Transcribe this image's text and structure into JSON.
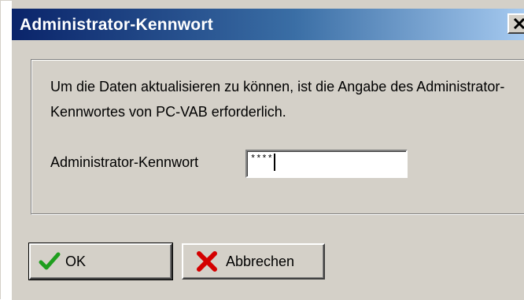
{
  "window": {
    "title": "Administrator-Kennwort"
  },
  "dialog": {
    "message": "Um die Daten aktualisieren zu können, ist die Angabe des Administrator-Kennwortes von PC-VAB erforderlich.",
    "password_label": "Administrator-Kennwort",
    "password_value": "****"
  },
  "buttons": {
    "ok_label": "OK",
    "cancel_label": "Abbrechen"
  },
  "icons": {
    "close": "close-icon",
    "ok": "checkmark-icon",
    "cancel": "x-mark-icon"
  },
  "colors": {
    "titlebar_start": "#0a246a",
    "titlebar_end": "#a6caf0",
    "face": "#d4d0c8",
    "ok_icon": "#1e9e1e",
    "cancel_icon": "#d40000"
  }
}
